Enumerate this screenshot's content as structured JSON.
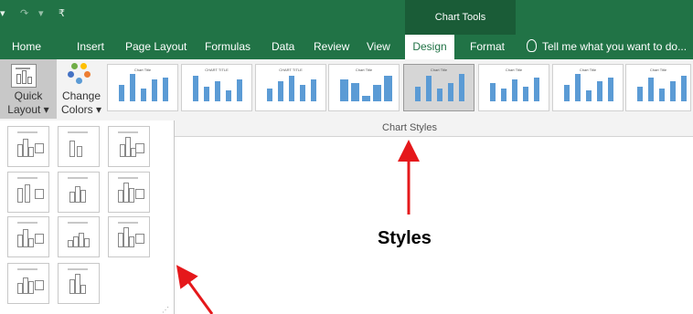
{
  "title_bar": {
    "quick_access": {
      "redo_glyph": "↷",
      "more_glyph": "▾",
      "customize_glyph": "₹"
    },
    "contextual_group": "Chart Tools"
  },
  "tabs": [
    {
      "label": "Home",
      "active": false
    },
    {
      "label": "Insert",
      "active": false
    },
    {
      "label": "Page Layout",
      "active": false
    },
    {
      "label": "Formulas",
      "active": false
    },
    {
      "label": "Data",
      "active": false
    },
    {
      "label": "Review",
      "active": false
    },
    {
      "label": "View",
      "active": false
    },
    {
      "label": "Design",
      "active": true
    },
    {
      "label": "Format",
      "active": false
    }
  ],
  "tell_me": {
    "text": "Tell me what you want to do...",
    "icon": "lightbulb-icon"
  },
  "ribbon": {
    "quick_layout": {
      "line1": "Quick",
      "line2": "Layout ▾"
    },
    "change_colors": {
      "line1": "Change",
      "line2": "Colors ▾"
    },
    "chart_styles_group_label": "Chart Styles",
    "chart_styles": [
      {
        "title": "Chart Title"
      },
      {
        "title": "CHART TITLE"
      },
      {
        "title": "CHART TITLE"
      },
      {
        "title": "Chart Title"
      },
      {
        "title": "Chart Title"
      },
      {
        "title": "Chart Title"
      },
      {
        "title": "Chart Title"
      },
      {
        "title": "Chart Title"
      }
    ]
  },
  "quick_layout_gallery": {
    "item_count": 11
  },
  "annotations": {
    "styles_label": "Styles"
  },
  "colors": {
    "excel_green": "#217346",
    "chart_tools_band": "#1a5c37",
    "bar_blue": "#5b9bd5",
    "annotation_red": "#e5181b"
  }
}
